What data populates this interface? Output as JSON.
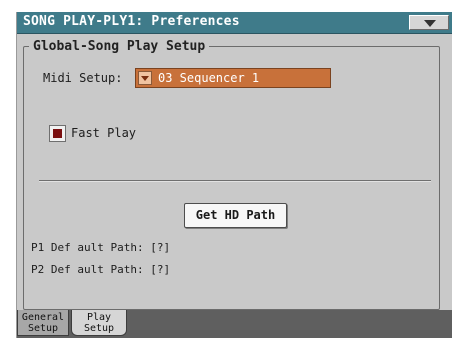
{
  "header": {
    "title": "SONG PLAY-PLY1: Preferences",
    "menu_icon": "chevron-down-icon"
  },
  "global_song_play_setup": {
    "section_title": "Global-Song Play Setup",
    "midi_setup": {
      "label": "Midi Setup:",
      "value": "03 Sequencer 1"
    },
    "fast_play": {
      "label": "Fast Play",
      "checked": true
    }
  },
  "hd_path": {
    "button_label": "Get HD Path",
    "p1_default_path": "P1 Def ault Path: [?]",
    "p2_default_path": "P2 Def ault Path: [?]"
  },
  "tabs": [
    {
      "line1": "General",
      "line2": "Setup",
      "active": false
    },
    {
      "line1": "Play",
      "line2": "Setup",
      "active": true
    }
  ],
  "colors": {
    "title_bar": "#3f7b8a",
    "panel_bg": "#c9c9c9",
    "field_orange": "#c8713a",
    "checkbox_mark": "#7a0f10"
  }
}
